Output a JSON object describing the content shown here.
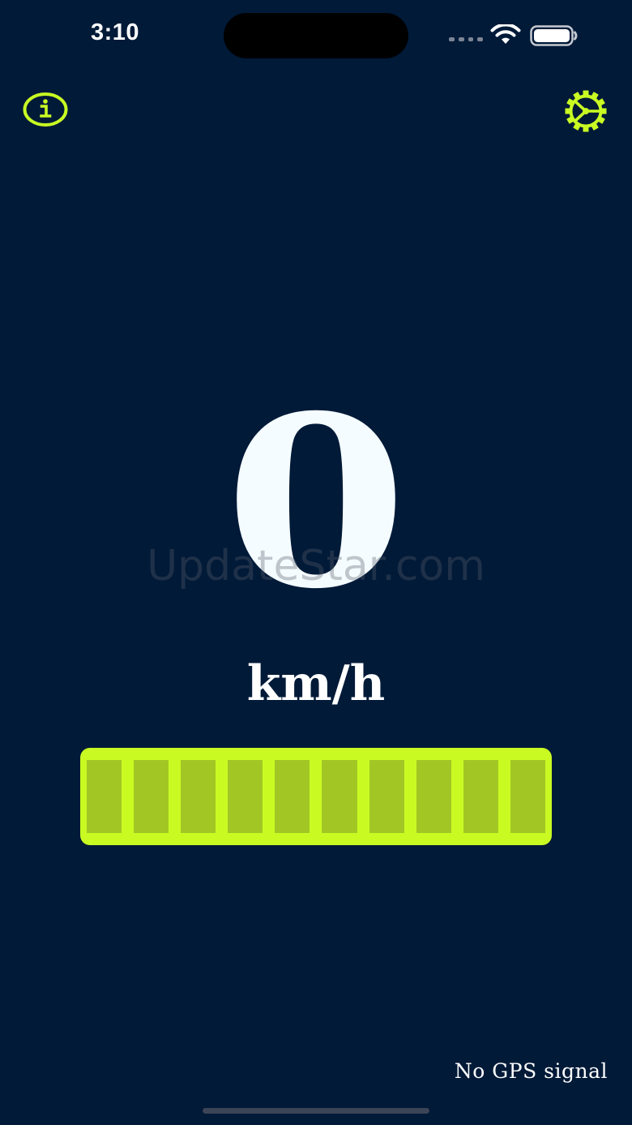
{
  "status_bar": {
    "time": "3:10",
    "wifi_icon": "wifi-icon",
    "battery_icon": "battery-icon"
  },
  "toolbar": {
    "info_icon": "info-icon",
    "settings_icon": "gear-icon"
  },
  "speedometer": {
    "value": "0",
    "unit": "km/h",
    "level": {
      "segments_total": 10,
      "segments_lit": 10
    }
  },
  "watermark": "UpdateStar.com",
  "gps": {
    "status": "No GPS signal"
  },
  "colors": {
    "background": "#001a38",
    "accent": "#c9fb23",
    "segment_fill": "#a2c725",
    "speed_text": "#f5fcff"
  }
}
